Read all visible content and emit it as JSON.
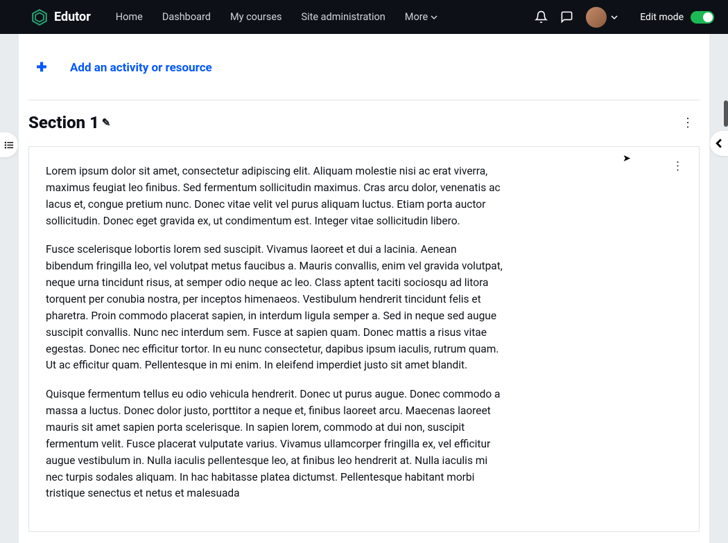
{
  "header": {
    "brand": "Edutor",
    "nav": [
      "Home",
      "Dashboard",
      "My courses",
      "Site administration",
      "More"
    ],
    "editMode": "Edit mode"
  },
  "addActivity": "Add an activity or resource",
  "section": {
    "title": "Section 1",
    "paragraphs": [
      "Lorem ipsum dolor sit amet, consectetur adipiscing elit. Aliquam molestie nisi ac erat viverra, maximus feugiat leo finibus. Sed fermentum sollicitudin maximus. Cras arcu dolor, venenatis ac lacus et, congue pretium nunc. Donec vitae velit vel purus aliquam luctus. Etiam porta auctor sollicitudin. Donec eget gravida ex, ut condimentum est. Integer vitae sollicitudin libero.",
      "Fusce scelerisque lobortis lorem sed suscipit. Vivamus laoreet et dui a lacinia. Aenean bibendum fringilla leo, vel volutpat metus faucibus a. Mauris convallis, enim vel gravida volutpat, neque urna tincidunt risus, at semper odio neque ac leo. Class aptent taciti sociosqu ad litora torquent per conubia nostra, per inceptos himenaeos. Vestibulum hendrerit tincidunt felis et pharetra. Proin commodo placerat sapien, in interdum ligula semper a. Sed in neque sed augue suscipit convallis. Nunc nec interdum sem. Fusce at sapien quam. Donec mattis a risus vitae egestas. Donec nec efficitur tortor. In eu nunc consectetur, dapibus ipsum iaculis, rutrum quam. Ut ac efficitur quam. Pellentesque in mi enim. In eleifend imperdiet justo sit amet blandit.",
      "Quisque fermentum tellus eu odio vehicula hendrerit. Donec ut purus augue. Donec commodo a massa a luctus. Donec dolor justo, porttitor a neque et, finibus laoreet arcu. Maecenas laoreet mauris sit amet sapien porta scelerisque. In sapien lorem, commodo at dui non, suscipit fermentum velit. Fusce placerat vulputate varius. Vivamus ullamcorper fringilla ex, vel efficitur augue vestibulum in. Nulla iaculis pellentesque leo, at finibus leo hendrerit at. Nulla iaculis mi nec turpis sodales aliquam. In hac habitasse platea dictumst. Pellentesque habitant morbi tristique senectus et netus et malesuada"
    ]
  }
}
